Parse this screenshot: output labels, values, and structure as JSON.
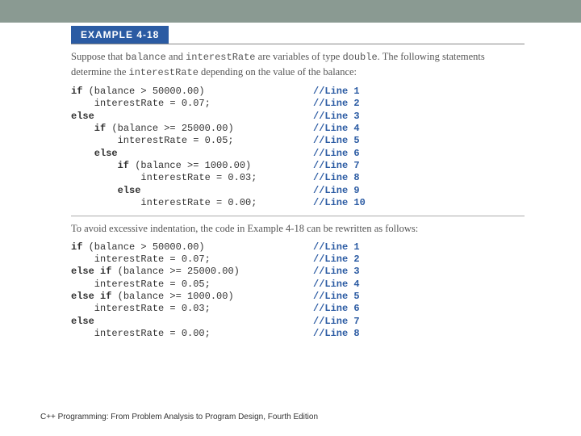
{
  "exampleLabel": "EXAMPLE 4-18",
  "para1_parts": [
    {
      "t": "Suppose that ",
      "mono": false
    },
    {
      "t": "balance",
      "mono": true
    },
    {
      "t": " and ",
      "mono": false
    },
    {
      "t": "interestRate",
      "mono": true
    },
    {
      "t": " are variables of type ",
      "mono": false
    },
    {
      "t": "double",
      "mono": true
    },
    {
      "t": ". The following statements determine the ",
      "mono": false
    },
    {
      "t": "interestRate",
      "mono": true
    },
    {
      "t": " depending on the value of the balance:",
      "mono": false
    }
  ],
  "code1_lines": [
    {
      "code": "if (balance > 50000.00)",
      "indent": 0,
      "kw": "if",
      "cmt": "//Line 1"
    },
    {
      "code": "interestRate = 0.07;",
      "indent": 4,
      "cmt": "//Line 2"
    },
    {
      "code": "else",
      "indent": 0,
      "kw": "else",
      "cmt": "//Line 3"
    },
    {
      "code": "if (balance >= 25000.00)",
      "indent": 4,
      "kw": "if",
      "cmt": "//Line 4"
    },
    {
      "code": "interestRate = 0.05;",
      "indent": 8,
      "cmt": "//Line 5"
    },
    {
      "code": "else",
      "indent": 4,
      "kw": "else",
      "cmt": "//Line 6"
    },
    {
      "code": "if (balance >= 1000.00)",
      "indent": 8,
      "kw": "if",
      "cmt": "//Line 7"
    },
    {
      "code": "interestRate = 0.03;",
      "indent": 12,
      "cmt": "//Line 8"
    },
    {
      "code": "else",
      "indent": 8,
      "kw": "else",
      "cmt": "//Line 9"
    },
    {
      "code": "interestRate = 0.00;",
      "indent": 12,
      "cmt": "//Line 10"
    }
  ],
  "code1_comment_col": 300,
  "para2": "To avoid excessive indentation, the code in Example 4-18 can be rewritten as follows:",
  "code2_lines": [
    {
      "code": "if (balance > 50000.00)",
      "indent": 0,
      "kw": "if",
      "cmt": "//Line 1"
    },
    {
      "code": "interestRate = 0.07;",
      "indent": 4,
      "cmt": "//Line 2"
    },
    {
      "code": "else if (balance >= 25000.00)",
      "indent": 0,
      "kw": "else if",
      "cmt": "//Line 3"
    },
    {
      "code": "interestRate = 0.05;",
      "indent": 4,
      "cmt": "//Line 4"
    },
    {
      "code": "else if (balance >= 1000.00)",
      "indent": 0,
      "kw": "else if",
      "cmt": "//Line 5"
    },
    {
      "code": "interestRate = 0.03;",
      "indent": 4,
      "cmt": "//Line 6"
    },
    {
      "code": "else",
      "indent": 0,
      "kw": "else",
      "cmt": "//Line 7"
    },
    {
      "code": "interestRate = 0.00;",
      "indent": 4,
      "cmt": "//Line 8"
    }
  ],
  "code2_comment_col": 300,
  "footer": "C++ Programming: From Problem Analysis to Program Design, Fourth Edition"
}
